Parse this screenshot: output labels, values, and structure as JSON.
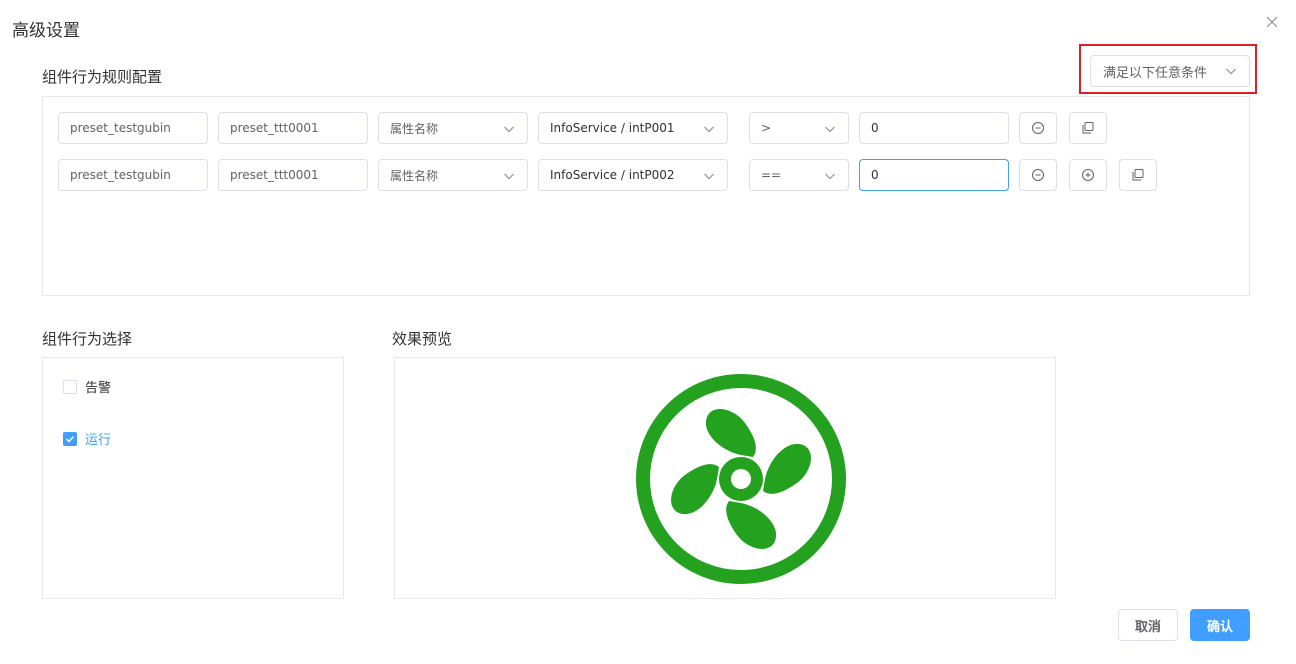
{
  "dialog": {
    "title": "高级设置"
  },
  "rules": {
    "label": "组件行为规则配置",
    "match_mode": "满足以下任意条件",
    "rows": [
      {
        "device": "preset_testgubin",
        "point": "preset_ttt0001",
        "attr_type": "属性名称",
        "attr": "InfoService / intP001",
        "operator": ">",
        "value": "0"
      },
      {
        "device": "preset_testgubin",
        "point": "preset_ttt0001",
        "attr_type": "属性名称",
        "attr": "InfoService / intP002",
        "operator": "==",
        "value": "0"
      }
    ]
  },
  "behavior": {
    "label": "组件行为选择",
    "options": [
      {
        "label": "告警",
        "checked": false
      },
      {
        "label": "运行",
        "checked": true
      }
    ]
  },
  "preview": {
    "label": "效果预览",
    "icon": "fan-icon",
    "color": "#23a11f"
  },
  "footer": {
    "cancel": "取消",
    "confirm": "确认"
  },
  "colors": {
    "primary": "#409eff",
    "highlight": "#e02020"
  }
}
